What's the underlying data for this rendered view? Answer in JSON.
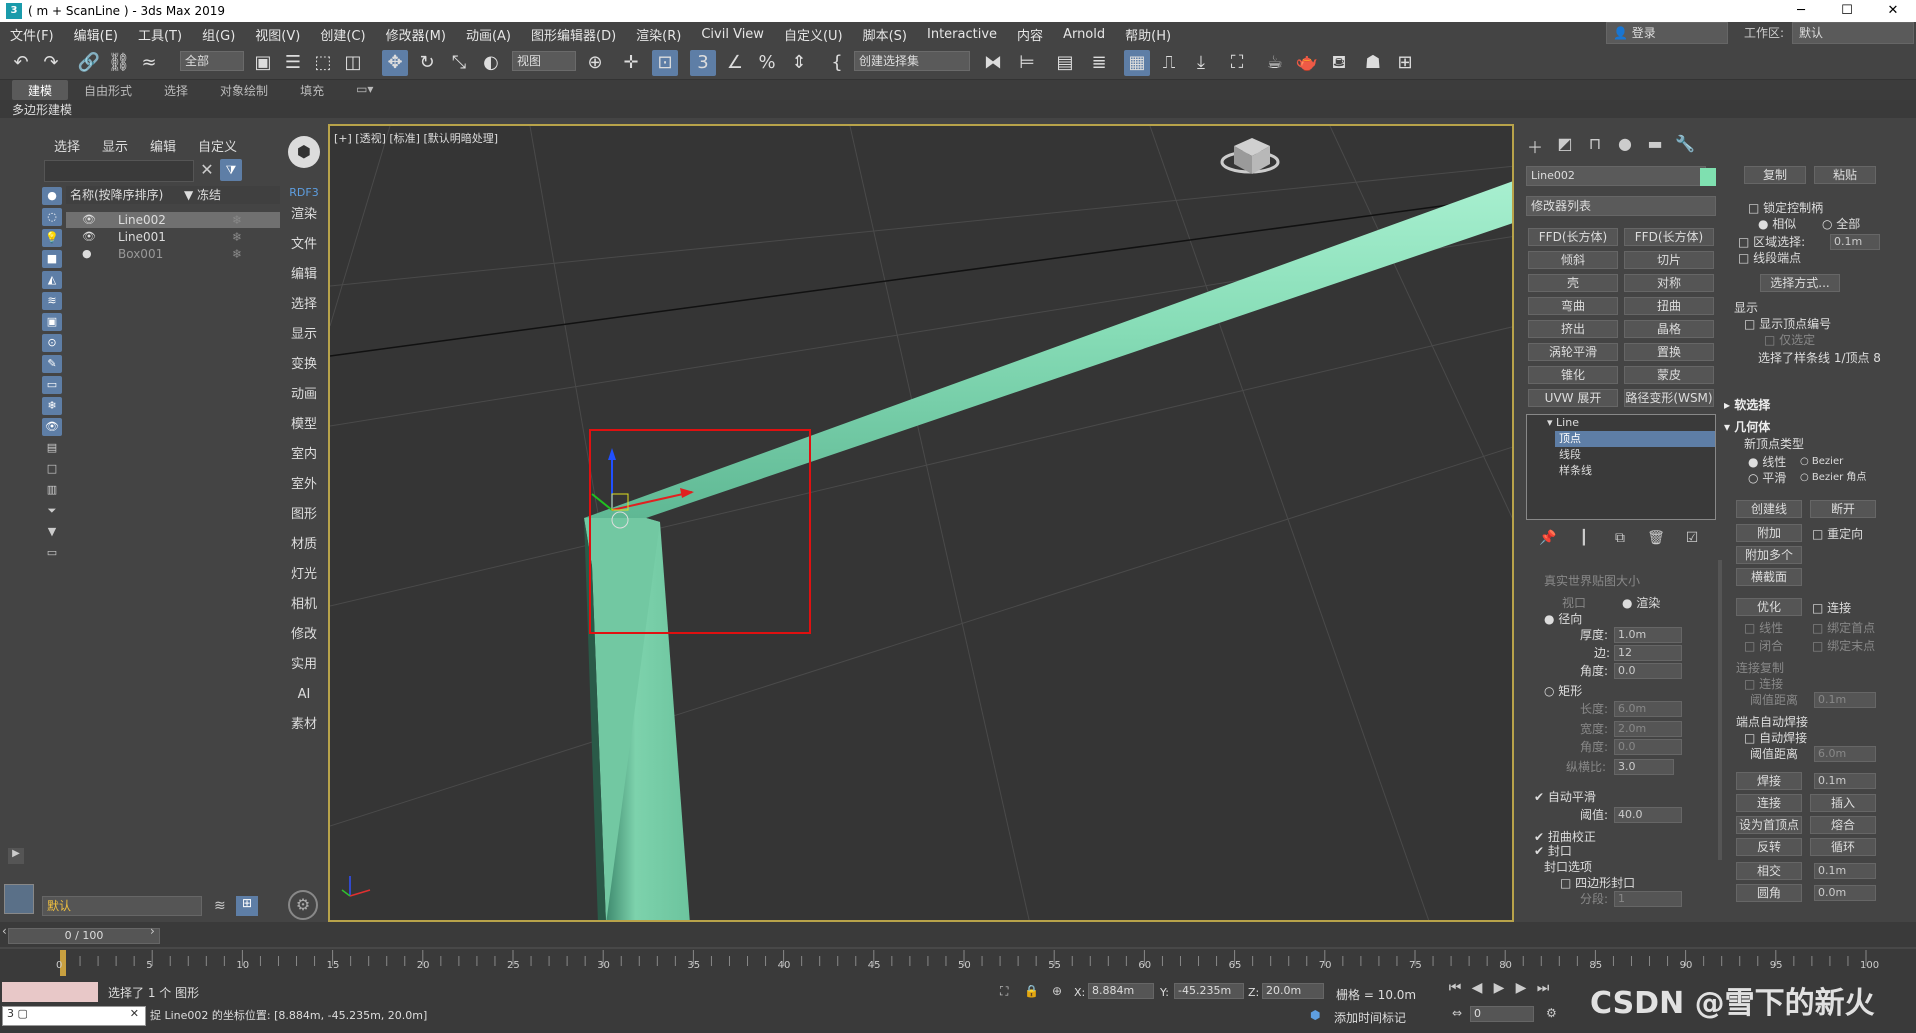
{
  "window": {
    "title": "( m + ScanLine ) - 3ds Max 2019",
    "minimize": "─",
    "maximize": "☐",
    "close": "✕"
  },
  "menu": [
    "文件(F)",
    "编辑(E)",
    "工具(T)",
    "组(G)",
    "视图(V)",
    "创建(C)",
    "修改器(M)",
    "动画(A)",
    "图形编辑器(D)",
    "渲染(R)",
    "Civil View",
    "自定义(U)",
    "脚本(S)",
    "Interactive",
    "内容",
    "Arnold",
    "帮助(H)"
  ],
  "login": "登录",
  "workspace_label": "工作区:",
  "workspace_value": "默认",
  "toolbar": {
    "filter_all": "全部",
    "view_dropdown": "视图",
    "selection_set": "创建选择集"
  },
  "ribbon": {
    "tabs": [
      "建模",
      "自由形式",
      "选择",
      "对象绘制",
      "填充"
    ],
    "active": "建模",
    "subtitle": "多边形建模"
  },
  "scene_explorer": {
    "tabs": [
      "选择",
      "显示",
      "编辑",
      "自定义"
    ],
    "col_name": "名称(按降序排序)",
    "col_freeze": "▼ 冻结",
    "rows": [
      {
        "name": "Line002",
        "selected": true
      },
      {
        "name": "Line001",
        "selected": false
      },
      {
        "name": "Box001",
        "selected": false
      }
    ],
    "layer_default": "默认"
  },
  "side_labels": [
    "RDF3",
    "渲染",
    "文件",
    "编辑",
    "选择",
    "显示",
    "变换",
    "动画",
    "模型",
    "室内",
    "室外",
    "图形",
    "材质",
    "灯光",
    "相机",
    "修改",
    "实用",
    "AI",
    "素材"
  ],
  "viewport": {
    "label": "[+] [透视] [标准] [默认明暗处理]"
  },
  "command_panel": {
    "object_name": "Line002",
    "object_color": "#7fe0b0",
    "modifier_list": "修改器列表",
    "buttons": [
      "FFD(长方体)",
      "FFD(长方体)",
      "倾斜",
      "切片",
      "壳",
      "对称",
      "弯曲",
      "扭曲",
      "挤出",
      "晶格",
      "涡轮平滑",
      "置换",
      "锥化",
      "蒙皮",
      "UVW 展开",
      "路径变形(WSM)"
    ],
    "stack": {
      "root": "Line",
      "items": [
        "顶点",
        "线段",
        "样条线"
      ],
      "active": "顶点"
    }
  },
  "rendering": {
    "title": "真实世界贴图大小",
    "viewport": "视口",
    "render": "渲染",
    "radial": "径向",
    "thickness_label": "厚度:",
    "thickness": "1.0m",
    "sides_label": "边:",
    "sides": "12",
    "angle_label": "角度:",
    "angle": "0.0",
    "rect": "矩形",
    "length_label": "长度:",
    "length": "6.0m",
    "width_label": "宽度:",
    "width": "2.0m",
    "angle2_label": "角度:",
    "angle2": "0.0",
    "aspect_label": "纵横比:",
    "aspect": "3.0",
    "auto_smooth": "自动平滑",
    "threshold_label": "阈值:",
    "threshold": "40.0",
    "twist": "扭曲校正",
    "cap": "封口",
    "cap_options": "封口选项",
    "quad_cap": "四边形封口",
    "segments_label": "分段:",
    "segments": "1"
  },
  "right_panel": {
    "copy": "复制",
    "paste": "粘贴",
    "lock_handles": "锁定控制柄",
    "similar": "相似",
    "all": "全部",
    "area_select": "区域选择:",
    "area_value": "0.1m",
    "segment_end": "线段端点",
    "select_by": "选择方式...",
    "display": "显示",
    "show_vertex_nums": "显示顶点编号",
    "selected_only": "仅选定",
    "sel_status": "选择了样条线 1/顶点 8",
    "soft_sel": "软选择",
    "geometry": "几何体",
    "new_vertex_type": "新顶点类型",
    "linear": "线性",
    "bezier": "Bezier",
    "smooth": "平滑",
    "bezier_corner": "Bezier 角点",
    "create_line": "创建线",
    "break": "断开",
    "attach": "附加",
    "reorient": "重定向",
    "attach_multi": "附加多个",
    "cross_section": "横截面",
    "refine": "优化",
    "connect": "连接",
    "linear2": "线性",
    "bind_first": "绑定首点",
    "closed": "闭合",
    "bind_last": "绑定末点",
    "connect_copy": "连接复制",
    "connect2": "连接",
    "threshold_dist": "阈值距离",
    "threshold_val": "0.1m",
    "end_auto_weld": "端点自动焊接",
    "auto_weld": "自动焊接",
    "threshold_dist2": "阈值距离",
    "weld_val": "6.0m",
    "weld": "焊接",
    "weld_amt": "0.1m",
    "connect3": "连接",
    "insert": "插入",
    "make_first": "设为首顶点",
    "fuse": "熔合",
    "reverse": "反转",
    "cycle": "循环",
    "crossinsert": "相交",
    "cross_amt": "0.1m",
    "fillet": "圆角",
    "fillet_amt": "0.0m"
  },
  "timeline": {
    "frame": "0 / 100",
    "ticks": [
      "0",
      "5",
      "10",
      "15",
      "20",
      "25",
      "30",
      "35",
      "40",
      "45",
      "50",
      "55",
      "60",
      "65",
      "70",
      "75",
      "80",
      "85",
      "90",
      "95",
      "100"
    ]
  },
  "status": {
    "selected": "选择了 1 个 图形",
    "prompt": "捉 Line002 的坐标位置: [8.884m, -45.235m, 20.0m]",
    "x_label": "X:",
    "x": "8.884m",
    "y_label": "Y:",
    "y": "-45.235m",
    "z_label": "Z:",
    "z": "20.0m",
    "grid": "栅格 = 10.0m",
    "add_time_tag": "添加时间标记",
    "frame_field": "0",
    "watermark": "CSDN @雪下的新火"
  }
}
